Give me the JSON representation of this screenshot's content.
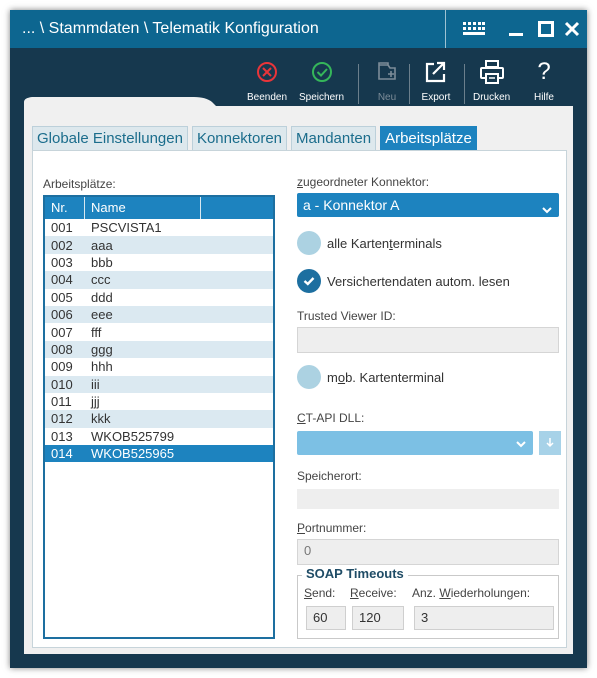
{
  "window": {
    "title": "... \\ Stammdaten \\ Telematik Konfiguration"
  },
  "titlebar_icons": {
    "keypad": "keypad-icon",
    "minimize": "minimize-icon",
    "maximize": "maximize-icon",
    "close": "close-icon"
  },
  "toolbar": {
    "beenden": "Beenden",
    "speichern": "Speichern",
    "neu": "Neu",
    "export": "Export",
    "drucken": "Drucken",
    "hilfe": "Hilfe",
    "beenden_color": "#e8353a",
    "speichern_color": "#35b65a"
  },
  "tabs": [
    {
      "label": "Globale Einstellungen",
      "active": false
    },
    {
      "label": "Konnektoren",
      "active": false
    },
    {
      "label": "Mandanten",
      "active": false
    },
    {
      "label": "Arbeitsplätze",
      "active": true
    }
  ],
  "list": {
    "label": "Arbeitsplätze:",
    "headers": {
      "nr": "Nr.",
      "name": "Name"
    },
    "rows": [
      {
        "nr": "001",
        "name": "PSCVISTA1"
      },
      {
        "nr": "002",
        "name": "aaa"
      },
      {
        "nr": "003",
        "name": "bbb"
      },
      {
        "nr": "004",
        "name": "ccc"
      },
      {
        "nr": "005",
        "name": "ddd"
      },
      {
        "nr": "006",
        "name": "eee"
      },
      {
        "nr": "007",
        "name": "fff"
      },
      {
        "nr": "008",
        "name": "ggg"
      },
      {
        "nr": "009",
        "name": "hhh"
      },
      {
        "nr": "010",
        "name": "iii"
      },
      {
        "nr": "011",
        "name": "jjj"
      },
      {
        "nr": "012",
        "name": "kkk"
      },
      {
        "nr": "013",
        "name": "WKOB525799"
      },
      {
        "nr": "014",
        "name": "WKOB525965"
      }
    ],
    "selected": "014"
  },
  "form": {
    "konnektor_label": "zugeordneter Konnektor:",
    "konnektor_value": "a - Konnektor A",
    "alle_kartenterminals": "alle Kartenterminals",
    "alle_kartenterminals_checked": false,
    "versichertendaten": "Versichertendaten autom. lesen",
    "versichertendaten_checked": true,
    "trusted_viewer_label": "Trusted Viewer ID:",
    "trusted_viewer_value": "",
    "mob_kartenterminal": "mob. Kartenterminal",
    "mob_kartenterminal_checked": false,
    "ctapi_label": "CT-API DLL:",
    "ctapi_value": "",
    "speicherort_label": "Speicherort:",
    "speicherort_value": "",
    "portnummer_label": "Portnummer:",
    "portnummer_value": "0"
  },
  "soap": {
    "title": "SOAP Timeouts",
    "send_label": "Send:",
    "receive_label": "Receive:",
    "wiederholungen_label": "Anz. Wiederholungen:",
    "send_value": "60",
    "receive_value": "120",
    "wiederholungen_value": "3"
  }
}
